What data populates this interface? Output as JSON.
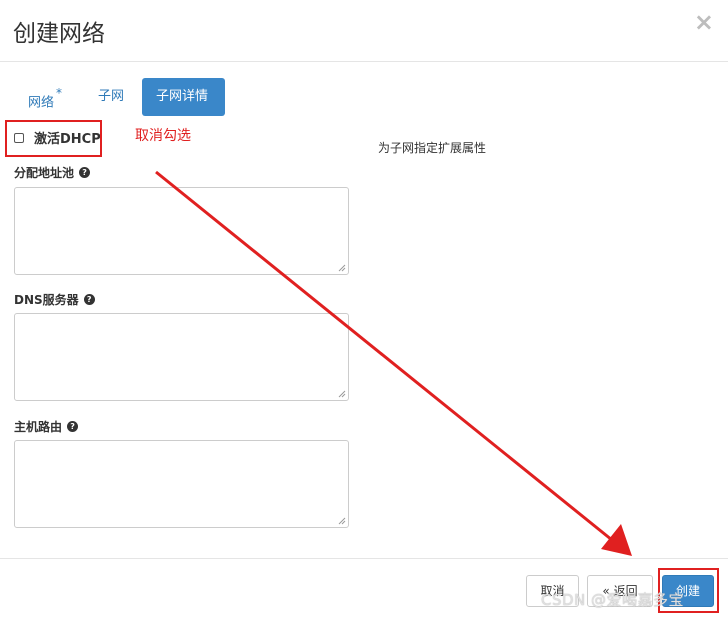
{
  "modal": {
    "title": "创建网络",
    "close_glyph": "×"
  },
  "tabs": [
    {
      "label": "网络",
      "required_mark": "*"
    },
    {
      "label": "子网"
    },
    {
      "label": "子网详情"
    }
  ],
  "form": {
    "dhcp_label": "激活DHCP",
    "dhcp_checked": false,
    "help_text": "为子网指定扩展属性",
    "fields": [
      {
        "label": "分配地址池",
        "value": ""
      },
      {
        "label": "DNS服务器",
        "value": ""
      },
      {
        "label": "主机路由",
        "value": ""
      }
    ]
  },
  "annotation": {
    "note": "取消勾选",
    "color": "#e02020"
  },
  "footer": {
    "cancel_label": "取消",
    "back_label": "« 返回",
    "create_label": "创建"
  },
  "watermark": "CSDN @爱喝嘉多宝",
  "colors": {
    "primary": "#3a87c9",
    "link": "#2f7ab8",
    "annotation_red": "#e02020"
  }
}
